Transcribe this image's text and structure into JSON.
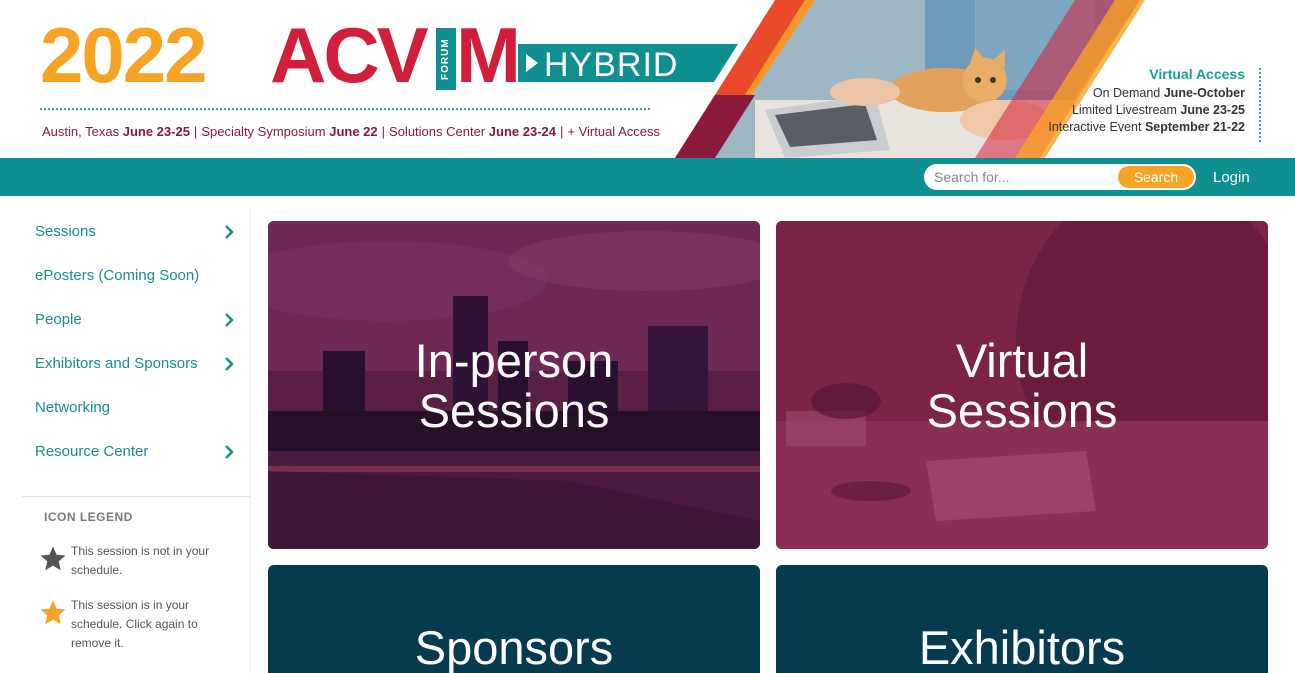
{
  "banner": {
    "year": "2022",
    "brand_acv": "ACV",
    "brand_forum": "FORUM",
    "brand_m": "M",
    "hybrid": "HYBRID",
    "tagline": {
      "city": "Austin, Texas",
      "city_dates": "June 23-25",
      "symposium": "Specialty Symposium",
      "symposium_date": "June 22",
      "solutions": "Solutions Center",
      "solutions_dates": "June 23-24",
      "virtual": "+ Virtual Access"
    },
    "virtual_access": {
      "title": "Virtual Access",
      "line1_label": "On Demand",
      "line1_value": "June-October",
      "line2_label": "Limited Livestream",
      "line2_value": "June 23-25",
      "line3_label": "Interactive Event",
      "line3_value": "September 21-22"
    }
  },
  "navbar": {
    "search_placeholder": "Search for...",
    "search_button": "Search",
    "login": "Login"
  },
  "sidebar": {
    "items": [
      {
        "label": "Sessions",
        "has_submenu": true
      },
      {
        "label": "ePosters (Coming Soon)",
        "has_submenu": false
      },
      {
        "label": "People",
        "has_submenu": true
      },
      {
        "label": "Exhibitors and Sponsors",
        "has_submenu": true
      },
      {
        "label": "Networking",
        "has_submenu": false
      },
      {
        "label": "Resource Center",
        "has_submenu": true
      }
    ],
    "legend": {
      "title": "ICON LEGEND",
      "items": [
        {
          "icon": "star-outline-icon",
          "text": "This session is not in your schedule."
        },
        {
          "icon": "star-filled-icon",
          "text": "This session is in your schedule. Click again to remove it."
        }
      ]
    }
  },
  "tiles": [
    {
      "label_line1": "In-person",
      "label_line2": "Sessions"
    },
    {
      "label_line1": "Virtual",
      "label_line2": "Sessions"
    },
    {
      "label_line1": "Sponsors"
    },
    {
      "label_line1": "Exhibitors"
    }
  ],
  "colors": {
    "teal": "#0f8f8f",
    "orange": "#f7a325",
    "crimson": "#d11f3b",
    "maroon": "#8c1a3a",
    "dark_navy": "#053a4f"
  }
}
